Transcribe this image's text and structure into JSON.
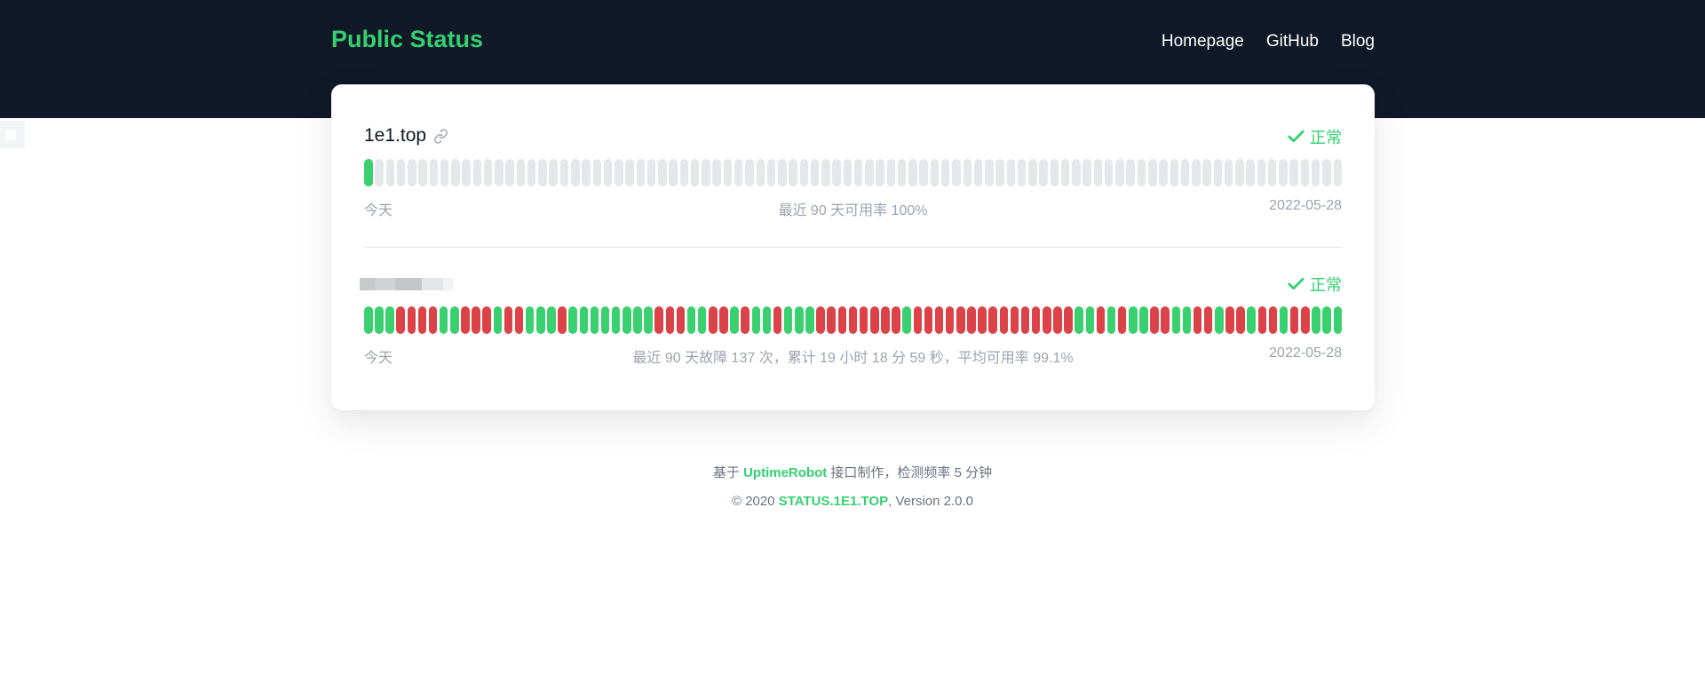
{
  "header": {
    "logo": "Public Status",
    "nav": [
      "Homepage",
      "GitHub",
      "Blog"
    ]
  },
  "monitors": [
    {
      "name": "1e1.top",
      "name_blurred": false,
      "status": "正常",
      "bars": "Gxxxxxxxxxxxxxxxxxxxxxxxxxxxxxxxxxxxxxxxxxxxxxxxxxxxxxxxxxxxxxxxxxxxxxxxxxxxxxxxxxxxxxxxxx",
      "left": "今天",
      "center": "最近 90 天可用率 100%",
      "right": "2022-05-28"
    },
    {
      "name": "",
      "name_blurred": true,
      "status": "正常",
      "bars": "GGGRRRRGGRRRGRRGGGRGGGGGGGGRRRGGRRGRGGRGGGRRRRRRRRGRRRRRRRRRRRRRRRGGRGRGGRRGGRRGRRGRRGRRGGG",
      "left": "今天",
      "center": "最近 90 天故障 137 次，累计 19 小时 18 分 59 秒，平均可用率 99.1%",
      "right": "2022-05-28"
    }
  ],
  "footer": {
    "line1_prefix": "基于 ",
    "line1_link": "UptimeRobot",
    "line1_suffix": " 接口制作，检测频率 5 分钟",
    "line2_prefix": "© 2020 ",
    "line2_link": "STATUS.1E1.TOP",
    "line2_suffix": ", Version 2.0.0"
  },
  "colors": {
    "up": "#3bd06f",
    "down": "#dc4349",
    "none": "#e5e7eb",
    "accent": "#34d070",
    "header_bg": "#111827"
  },
  "icons": {
    "link": "link-icon",
    "status": "check-icon"
  }
}
